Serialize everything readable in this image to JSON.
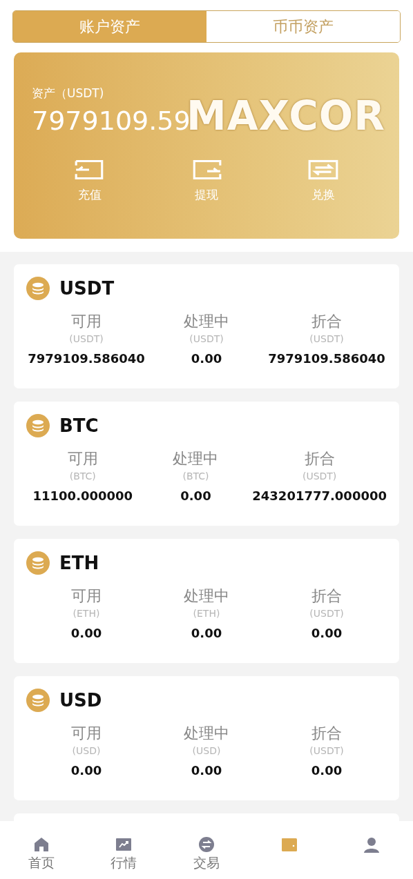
{
  "tabs": [
    {
      "label": "账户资产",
      "selected": true
    },
    {
      "label": "币币资产",
      "selected": false
    }
  ],
  "summary": {
    "label": "资产（USDT)",
    "value": "7979109.59",
    "brand": "MAXCOR",
    "actions": [
      {
        "kind": "deposit",
        "label": "充值"
      },
      {
        "kind": "withdraw",
        "label": "提现"
      },
      {
        "kind": "exchange",
        "label": "兑换"
      }
    ]
  },
  "assets": [
    {
      "name": "USDT",
      "columns": [
        {
          "label": "可用",
          "unit": "(USDT)",
          "value": "7979109.586040"
        },
        {
          "label": "处理中",
          "unit": "(USDT)",
          "value": "0.00"
        },
        {
          "label": "折合",
          "unit": "(USDT)",
          "value": "7979109.586040"
        }
      ]
    },
    {
      "name": "BTC",
      "columns": [
        {
          "label": "可用",
          "unit": "(BTC)",
          "value": "11100.000000"
        },
        {
          "label": "处理中",
          "unit": "(BTC)",
          "value": "0.00"
        },
        {
          "label": "折合",
          "unit": "(USDT)",
          "value": "243201777.000000"
        }
      ]
    },
    {
      "name": "ETH",
      "columns": [
        {
          "label": "可用",
          "unit": "(ETH)",
          "value": "0.00"
        },
        {
          "label": "处理中",
          "unit": "(ETH)",
          "value": "0.00"
        },
        {
          "label": "折合",
          "unit": "(USDT)",
          "value": "0.00"
        }
      ]
    },
    {
      "name": "USD",
      "columns": [
        {
          "label": "可用",
          "unit": "(USD)",
          "value": "0.00"
        },
        {
          "label": "处理中",
          "unit": "(USD)",
          "value": "0.00"
        },
        {
          "label": "折合",
          "unit": "(USDT)",
          "value": "0.00"
        }
      ]
    }
  ],
  "nav": [
    {
      "kind": "home",
      "label": "首页",
      "selected": false
    },
    {
      "kind": "market",
      "label": "行情",
      "selected": false
    },
    {
      "kind": "trade",
      "label": "交易",
      "selected": false
    },
    {
      "kind": "wallet",
      "selected": true
    },
    {
      "kind": "user",
      "selected": false
    }
  ]
}
